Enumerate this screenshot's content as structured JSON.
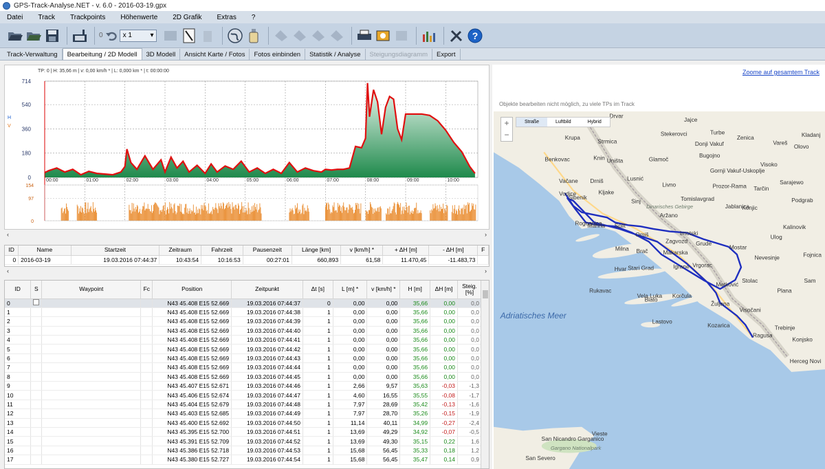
{
  "window": {
    "title": "GPS-Track-Analyse.NET  -  v. 6.0  -  2016-03-19.gpx"
  },
  "menu": [
    "Datei",
    "Track",
    "Trackpoints",
    "Höhenwerte",
    "2D Grafik",
    "Extras",
    "?"
  ],
  "toolbar": {
    "undo_count": "0",
    "zoom_value": "x 1"
  },
  "tabs": [
    {
      "label": "Track-Verwaltung",
      "state": "normal"
    },
    {
      "label": "Bearbeitung / 2D Modell",
      "state": "active"
    },
    {
      "label": "3D Modell",
      "state": "normal"
    },
    {
      "label": "Ansicht Karte / Fotos",
      "state": "normal"
    },
    {
      "label": "Fotos einbinden",
      "state": "normal"
    },
    {
      "label": "Statistik / Analyse",
      "state": "normal"
    },
    {
      "label": "Steigungsdiagramm",
      "state": "disabled"
    },
    {
      "label": "Export",
      "state": "normal"
    }
  ],
  "chart_status": "TP: 0 | H: 35,66 m | v: 0,00 km/h * | L: 0,000 km * | t: 00:00:00",
  "chart_data": {
    "type": "area",
    "y_axis_label_h": "H",
    "y_axis_label_v": "V",
    "height_ticks": [
      "714",
      "540",
      "360",
      "180",
      "0"
    ],
    "speed_ticks": [
      "154",
      "97",
      "0"
    ],
    "ylim_height": [
      0,
      714
    ],
    "ylim_speed": [
      0,
      154
    ],
    "x_ticks": [
      "00:00",
      "01:00",
      "02:00",
      "03:00",
      "04:00",
      "05:00",
      "06:00",
      "07:00",
      "08:00",
      "09:00",
      "10:00"
    ],
    "height_series": {
      "name": "H",
      "times_h": [
        0,
        0.1,
        0.3,
        0.5,
        0.7,
        0.9,
        1.1,
        1.3,
        1.5,
        1.7,
        1.9,
        2.0,
        2.05,
        2.15,
        2.3,
        2.5,
        2.7,
        2.9,
        3.0,
        3.15,
        3.3,
        3.45,
        3.6,
        3.8,
        4.0,
        4.15,
        4.3,
        4.5,
        4.7,
        4.9,
        5.1,
        5.3,
        5.5,
        5.7,
        5.9,
        6.1,
        6.3,
        6.5,
        6.7,
        6.9,
        7.0,
        7.15,
        7.3,
        7.45,
        7.6,
        7.75,
        7.9,
        8.0,
        8.05,
        8.1,
        8.2,
        8.3,
        8.4,
        8.5,
        8.6,
        8.7,
        8.8,
        8.9,
        9.0,
        9.2,
        9.4,
        9.6,
        9.8,
        10.0,
        10.2,
        10.4,
        10.6,
        10.73
      ],
      "values": [
        36,
        50,
        70,
        40,
        60,
        20,
        45,
        30,
        25,
        20,
        40,
        80,
        210,
        110,
        60,
        160,
        60,
        130,
        40,
        150,
        70,
        120,
        40,
        90,
        30,
        100,
        40,
        85,
        60,
        120,
        40,
        70,
        30,
        60,
        30,
        110,
        40,
        70,
        50,
        40,
        60,
        55,
        60,
        60,
        70,
        230,
        220,
        290,
        700,
        450,
        650,
        560,
        320,
        520,
        600,
        580,
        360,
        280,
        470,
        470,
        470,
        460,
        420,
        350,
        260,
        190,
        80,
        30
      ]
    },
    "speed_series": {
      "name": "V",
      "gaps_h": [
        [
          0,
          0.4
        ],
        [
          0.6,
          0.8
        ],
        [
          1.3,
          2.1
        ],
        [
          5.4,
          6.1
        ],
        [
          6.6,
          7.0
        ],
        [
          7.9,
          8.0
        ],
        [
          8.4,
          8.5
        ],
        [
          9.4,
          9.6
        ],
        [
          10.05,
          10.15
        ]
      ],
      "typical_speed": 60
    }
  },
  "track_table": {
    "headers": [
      "ID",
      "Name",
      "Startzeit",
      "Zeitraum",
      "Fahrzeit",
      "Pausenzeit",
      "Länge [km]",
      "v [km/h] *",
      "+ ΔH [m]",
      "- ΔH [m]",
      "F"
    ],
    "rows": [
      [
        "0",
        "2016-03-19",
        "19.03.2016 07:44:37",
        "10:43:54",
        "10:16:53",
        "00:27:01",
        "660,893",
        "61,58",
        "11.470,45",
        "-11.483,73",
        ""
      ]
    ]
  },
  "wp_table": {
    "headers": [
      "ID",
      "S",
      "Waypoint",
      "Fc",
      "Position",
      "Zeitpunkt",
      "Δt [s]",
      "L [m] *",
      "v [km/h] *",
      "H [m]",
      "ΔH [m]",
      "Steig. [%]"
    ],
    "rows": [
      [
        "0",
        "",
        "",
        "",
        "N43 45.408 E15 52.669",
        "19.03.2016 07:44:37",
        "0",
        "0,00",
        "0,00",
        "35,66",
        "0,00",
        "0,0"
      ],
      [
        "1",
        "",
        "",
        "",
        "N43 45.408 E15 52.669",
        "19.03.2016 07:44:38",
        "1",
        "0,00",
        "0,00",
        "35,66",
        "0,00",
        "0,0"
      ],
      [
        "2",
        "",
        "",
        "",
        "N43 45.408 E15 52.669",
        "19.03.2016 07:44:39",
        "1",
        "0,00",
        "0,00",
        "35,66",
        "0,00",
        "0,0"
      ],
      [
        "3",
        "",
        "",
        "",
        "N43 45.408 E15 52.669",
        "19.03.2016 07:44:40",
        "1",
        "0,00",
        "0,00",
        "35,66",
        "0,00",
        "0,0"
      ],
      [
        "4",
        "",
        "",
        "",
        "N43 45.408 E15 52.669",
        "19.03.2016 07:44:41",
        "1",
        "0,00",
        "0,00",
        "35,66",
        "0,00",
        "0,0"
      ],
      [
        "5",
        "",
        "",
        "",
        "N43 45.408 E15 52.669",
        "19.03.2016 07:44:42",
        "1",
        "0,00",
        "0,00",
        "35,66",
        "0,00",
        "0,0"
      ],
      [
        "6",
        "",
        "",
        "",
        "N43 45.408 E15 52.669",
        "19.03.2016 07:44:43",
        "1",
        "0,00",
        "0,00",
        "35,66",
        "0,00",
        "0,0"
      ],
      [
        "7",
        "",
        "",
        "",
        "N43 45.408 E15 52.669",
        "19.03.2016 07:44:44",
        "1",
        "0,00",
        "0,00",
        "35,66",
        "0,00",
        "0,0"
      ],
      [
        "8",
        "",
        "",
        "",
        "N43 45.408 E15 52.669",
        "19.03.2016 07:44:45",
        "1",
        "0,00",
        "0,00",
        "35,66",
        "0,00",
        "0,0"
      ],
      [
        "9",
        "",
        "",
        "",
        "N43 45.407 E15 52.671",
        "19.03.2016 07:44:46",
        "1",
        "2,66",
        "9,57",
        "35,63",
        "-0,03",
        "-1,3"
      ],
      [
        "10",
        "",
        "",
        "",
        "N43 45.406 E15 52.674",
        "19.03.2016 07:44:47",
        "1",
        "4,60",
        "16,55",
        "35,55",
        "-0,08",
        "-1,7"
      ],
      [
        "11",
        "",
        "",
        "",
        "N43 45.404 E15 52.679",
        "19.03.2016 07:44:48",
        "1",
        "7,97",
        "28,69",
        "35,42",
        "-0,13",
        "-1,6"
      ],
      [
        "12",
        "",
        "",
        "",
        "N43 45.403 E15 52.685",
        "19.03.2016 07:44:49",
        "1",
        "7,97",
        "28,70",
        "35,26",
        "-0,15",
        "-1,9"
      ],
      [
        "13",
        "",
        "",
        "",
        "N43 45.400 E15 52.692",
        "19.03.2016 07:44:50",
        "1",
        "11,14",
        "40,11",
        "34,99",
        "-0,27",
        "-2,4"
      ],
      [
        "14",
        "",
        "",
        "",
        "N43 45.395 E15 52.700",
        "19.03.2016 07:44:51",
        "1",
        "13,69",
        "49,29",
        "34,92",
        "-0,07",
        "-0,5"
      ],
      [
        "15",
        "",
        "",
        "",
        "N43 45.391 E15 52.709",
        "19.03.2016 07:44:52",
        "1",
        "13,69",
        "49,30",
        "35,15",
        "0,22",
        "1,6"
      ],
      [
        "16",
        "",
        "",
        "",
        "N43 45.386 E15 52.718",
        "19.03.2016 07:44:53",
        "1",
        "15,68",
        "56,45",
        "35,33",
        "0,18",
        "1,2"
      ],
      [
        "17",
        "",
        "",
        "",
        "N43 45.380 E15 52.727",
        "19.03.2016 07:44:54",
        "1",
        "15,68",
        "56,45",
        "35,47",
        "0,14",
        "0,9"
      ]
    ]
  },
  "map": {
    "zoom_all_link": "Zoome auf gesamtem Track",
    "note": "Objekte bearbeiten nicht möglich, zu viele TPs im Track",
    "modes": [
      "Straße",
      "Luftbild",
      "Hybrid"
    ],
    "sea_label": "Adriatisches Meer",
    "places": [
      {
        "name": "Drvar",
        "lon": 16.38,
        "lat": 44.37
      },
      {
        "name": "Jajce",
        "lon": 17.27,
        "lat": 44.34
      },
      {
        "name": "Krupa",
        "lon": 15.85,
        "lat": 44.2
      },
      {
        "name": "Strmica",
        "lon": 16.24,
        "lat": 44.17
      },
      {
        "name": "Stekerovci",
        "lon": 16.99,
        "lat": 44.23
      },
      {
        "name": "Turbe",
        "lon": 17.58,
        "lat": 44.24
      },
      {
        "name": "Zenica",
        "lon": 17.9,
        "lat": 44.2
      },
      {
        "name": "Kladanj",
        "lon": 18.67,
        "lat": 44.22
      },
      {
        "name": "Donji Vakuf",
        "lon": 17.4,
        "lat": 44.15
      },
      {
        "name": "Vareš",
        "lon": 18.33,
        "lat": 44.16
      },
      {
        "name": "Olovo",
        "lon": 18.58,
        "lat": 44.13
      },
      {
        "name": "Benkovac",
        "lon": 15.61,
        "lat": 44.03
      },
      {
        "name": "Knin",
        "lon": 16.19,
        "lat": 44.04
      },
      {
        "name": "Uništa",
        "lon": 16.35,
        "lat": 44.02
      },
      {
        "name": "Glamoč",
        "lon": 16.85,
        "lat": 44.03
      },
      {
        "name": "Bugojno",
        "lon": 17.45,
        "lat": 44.06
      },
      {
        "name": "Gornji Vakuf-Uskoplje",
        "lon": 17.58,
        "lat": 43.94
      },
      {
        "name": "Visoko",
        "lon": 18.18,
        "lat": 43.99
      },
      {
        "name": "Vodice",
        "lon": 15.78,
        "lat": 43.76
      },
      {
        "name": "Vačane",
        "lon": 15.78,
        "lat": 43.86
      },
      {
        "name": "Drniš",
        "lon": 16.15,
        "lat": 43.86
      },
      {
        "name": "Lusnić",
        "lon": 16.59,
        "lat": 43.88
      },
      {
        "name": "Livno",
        "lon": 17.01,
        "lat": 43.83
      },
      {
        "name": "Prozor-Rama",
        "lon": 17.61,
        "lat": 43.82
      },
      {
        "name": "Tarčin",
        "lon": 18.1,
        "lat": 43.8
      },
      {
        "name": "Sarajewo",
        "lon": 18.41,
        "lat": 43.85
      },
      {
        "name": "Sibenik",
        "lon": 15.89,
        "lat": 43.73
      },
      {
        "name": "Kljake",
        "lon": 16.25,
        "lat": 43.77
      },
      {
        "name": "Sinj",
        "lon": 16.64,
        "lat": 43.7
      },
      {
        "name": "Tomislavgrad",
        "lon": 17.23,
        "lat": 43.72
      },
      {
        "name": "Konjic",
        "lon": 17.96,
        "lat": 43.65
      },
      {
        "name": "Podgrab",
        "lon": 18.55,
        "lat": 43.71
      },
      {
        "name": "Rogoznica",
        "lon": 15.97,
        "lat": 43.53
      },
      {
        "name": "Marina",
        "lon": 16.12,
        "lat": 43.51
      },
      {
        "name": "Split",
        "lon": 16.44,
        "lat": 43.51
      },
      {
        "name": "Jablanica",
        "lon": 17.76,
        "lat": 43.66
      },
      {
        "name": "Kalinovik",
        "lon": 18.45,
        "lat": 43.5
      },
      {
        "name": "Aržano",
        "lon": 16.98,
        "lat": 43.59
      },
      {
        "name": "Imotski",
        "lon": 17.22,
        "lat": 43.45
      },
      {
        "name": "Ulog",
        "lon": 18.3,
        "lat": 43.42
      },
      {
        "name": "Omiš",
        "lon": 16.69,
        "lat": 43.44
      },
      {
        "name": "Zagvozd",
        "lon": 17.05,
        "lat": 43.39
      },
      {
        "name": "Mostar",
        "lon": 17.81,
        "lat": 43.34
      },
      {
        "name": "Milna",
        "lon": 16.45,
        "lat": 43.33
      },
      {
        "name": "Brač",
        "lon": 16.7,
        "lat": 43.31
      },
      {
        "name": "Makarska",
        "lon": 17.02,
        "lat": 43.3
      },
      {
        "name": "Grude",
        "lon": 17.41,
        "lat": 43.37
      },
      {
        "name": "Fojnica",
        "lon": 18.69,
        "lat": 43.28
      },
      {
        "name": "Nevesinje",
        "lon": 18.11,
        "lat": 43.26
      },
      {
        "name": "Vrgorac",
        "lon": 17.37,
        "lat": 43.2
      },
      {
        "name": "Hvar",
        "lon": 16.44,
        "lat": 43.17
      },
      {
        "name": "Stari Grad",
        "lon": 16.6,
        "lat": 43.18
      },
      {
        "name": "Igrane",
        "lon": 17.14,
        "lat": 43.19
      },
      {
        "name": "Stolac",
        "lon": 17.96,
        "lat": 43.08
      },
      {
        "name": "Sam",
        "lon": 18.7,
        "lat": 43.08
      },
      {
        "name": "Rukavac",
        "lon": 16.14,
        "lat": 43.0
      },
      {
        "name": "Metković",
        "lon": 17.65,
        "lat": 43.05
      },
      {
        "name": "Vela Luka",
        "lon": 16.71,
        "lat": 42.96
      },
      {
        "name": "Blato",
        "lon": 16.8,
        "lat": 42.93
      },
      {
        "name": "Korčula",
        "lon": 17.13,
        "lat": 42.96
      },
      {
        "name": "Plana",
        "lon": 18.38,
        "lat": 43.0
      },
      {
        "name": "Žuljana",
        "lon": 17.59,
        "lat": 42.9
      },
      {
        "name": "Visočani",
        "lon": 17.93,
        "lat": 42.85
      },
      {
        "name": "Lastovo",
        "lon": 16.89,
        "lat": 42.76
      },
      {
        "name": "Kozarica",
        "lon": 17.55,
        "lat": 42.73
      },
      {
        "name": "Trebinje",
        "lon": 18.35,
        "lat": 42.71
      },
      {
        "name": "Ragusa",
        "lon": 18.09,
        "lat": 42.65
      },
      {
        "name": "Konjsko",
        "lon": 18.56,
        "lat": 42.62
      },
      {
        "name": "Herceg Novi",
        "lon": 18.53,
        "lat": 42.45
      },
      {
        "name": "San Nicandro Garganico",
        "lon": 15.57,
        "lat": 41.84
      },
      {
        "name": "Vieste",
        "lon": 16.17,
        "lat": 41.88
      },
      {
        "name": "San Severo",
        "lon": 15.38,
        "lat": 41.69
      }
    ],
    "map_italic_labels": [
      {
        "name": "Dinarisches Gebirge",
        "lon": 16.82,
        "lat": 43.66
      },
      {
        "name": "Gargano Nationalpark",
        "lon": 15.68,
        "lat": 41.77
      }
    ],
    "track": [
      [
        15.85,
        43.78
      ],
      [
        15.95,
        43.68
      ],
      [
        16.05,
        43.63
      ],
      [
        16.2,
        43.61
      ],
      [
        16.35,
        43.59
      ],
      [
        16.45,
        43.55
      ],
      [
        16.6,
        43.53
      ],
      [
        16.75,
        43.52
      ],
      [
        16.9,
        43.5
      ],
      [
        17.1,
        43.48
      ],
      [
        17.3,
        43.47
      ],
      [
        17.5,
        43.42
      ],
      [
        17.65,
        43.39
      ],
      [
        17.8,
        43.36
      ],
      [
        17.9,
        43.3
      ],
      [
        17.95,
        43.2
      ],
      [
        17.88,
        43.1
      ],
      [
        17.7,
        43.03
      ],
      [
        17.5,
        43.1
      ],
      [
        17.2,
        43.22
      ],
      [
        17.0,
        43.3
      ],
      [
        16.85,
        43.4
      ],
      [
        16.65,
        43.47
      ],
      [
        16.45,
        43.52
      ],
      [
        16.25,
        43.53
      ],
      [
        16.1,
        43.55
      ],
      [
        15.98,
        43.65
      ],
      [
        15.88,
        43.74
      ],
      [
        15.95,
        43.72
      ],
      [
        16.2,
        43.55
      ],
      [
        16.5,
        43.5
      ],
      [
        16.95,
        43.4
      ],
      [
        17.3,
        43.23
      ],
      [
        17.55,
        43.08
      ],
      [
        17.65,
        43.0
      ],
      [
        17.7,
        42.92
      ],
      [
        17.9,
        42.82
      ],
      [
        18.0,
        42.75
      ],
      [
        18.09,
        42.65
      ]
    ]
  }
}
